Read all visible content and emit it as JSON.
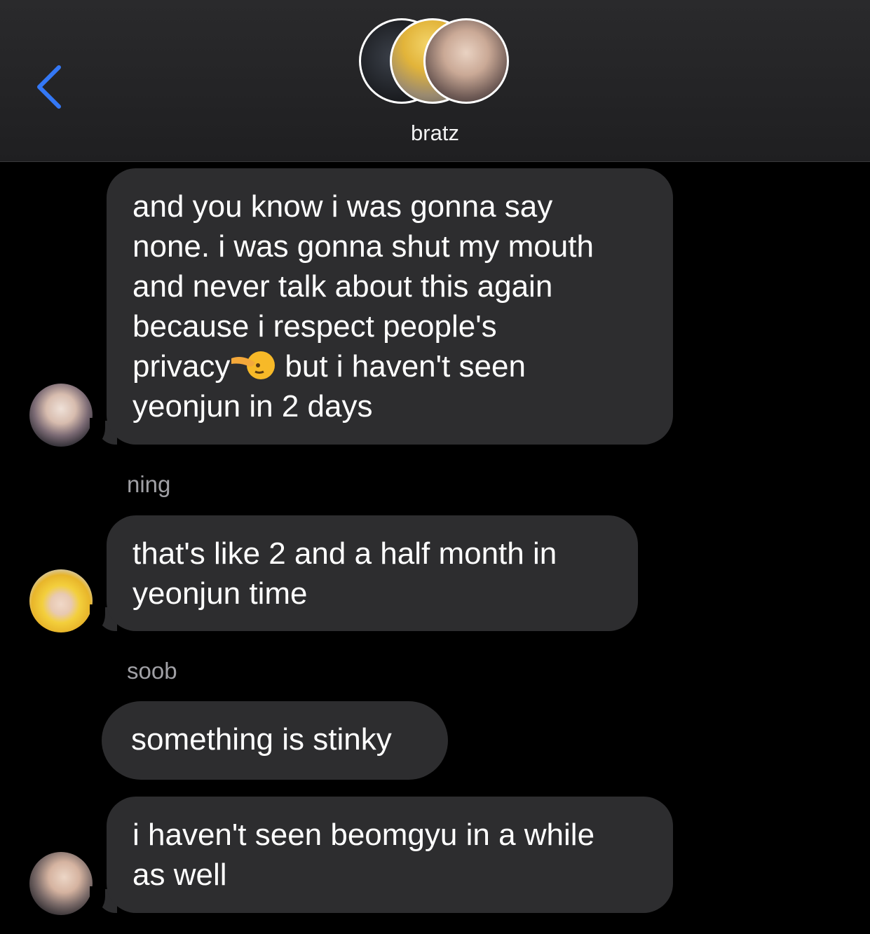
{
  "header": {
    "title": "bratz",
    "colors": {
      "back_arrow": "#3478f6",
      "bubble": "#2d2d2f",
      "background": "#000000"
    }
  },
  "messages": [
    {
      "lines": [
        "and you know i was gonna say",
        "none. i was gonna shut my mouth",
        "and never talk about this again",
        "because i respect people's",
        "privacy",
        "but i haven't seen",
        "yeonjun in 2 days"
      ],
      "emoji": "saluting-face-emoji"
    },
    {
      "sender": "ning",
      "lines": [
        "that's like 2 and a half month in",
        "yeonjun time"
      ]
    },
    {
      "sender": "soob",
      "lines": [
        "something is stinky"
      ]
    },
    {
      "lines": [
        "i haven't seen beomgyu in a while",
        "as well"
      ]
    }
  ]
}
